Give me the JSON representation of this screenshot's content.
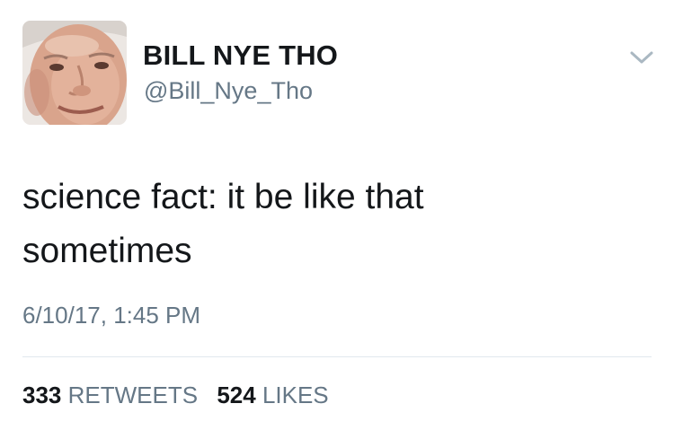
{
  "tweet": {
    "user": {
      "display_name": "BILL NYE THO",
      "handle": "@Bill_Nye_Tho",
      "avatar_icon": "profile-photo"
    },
    "menu_icon": "chevron-down-icon",
    "text_line1": "science fact: it be like that",
    "text_line2": "sometimes",
    "timestamp": "6/10/17, 1:45 PM",
    "stats": {
      "retweets_count": "333",
      "retweets_label": "RETWEETS",
      "likes_count": "524",
      "likes_label": "LIKES"
    }
  },
  "colors": {
    "primary_text": "#14171a",
    "secondary_text": "#657786",
    "divider": "#e1e8ed",
    "background": "#ffffff"
  }
}
